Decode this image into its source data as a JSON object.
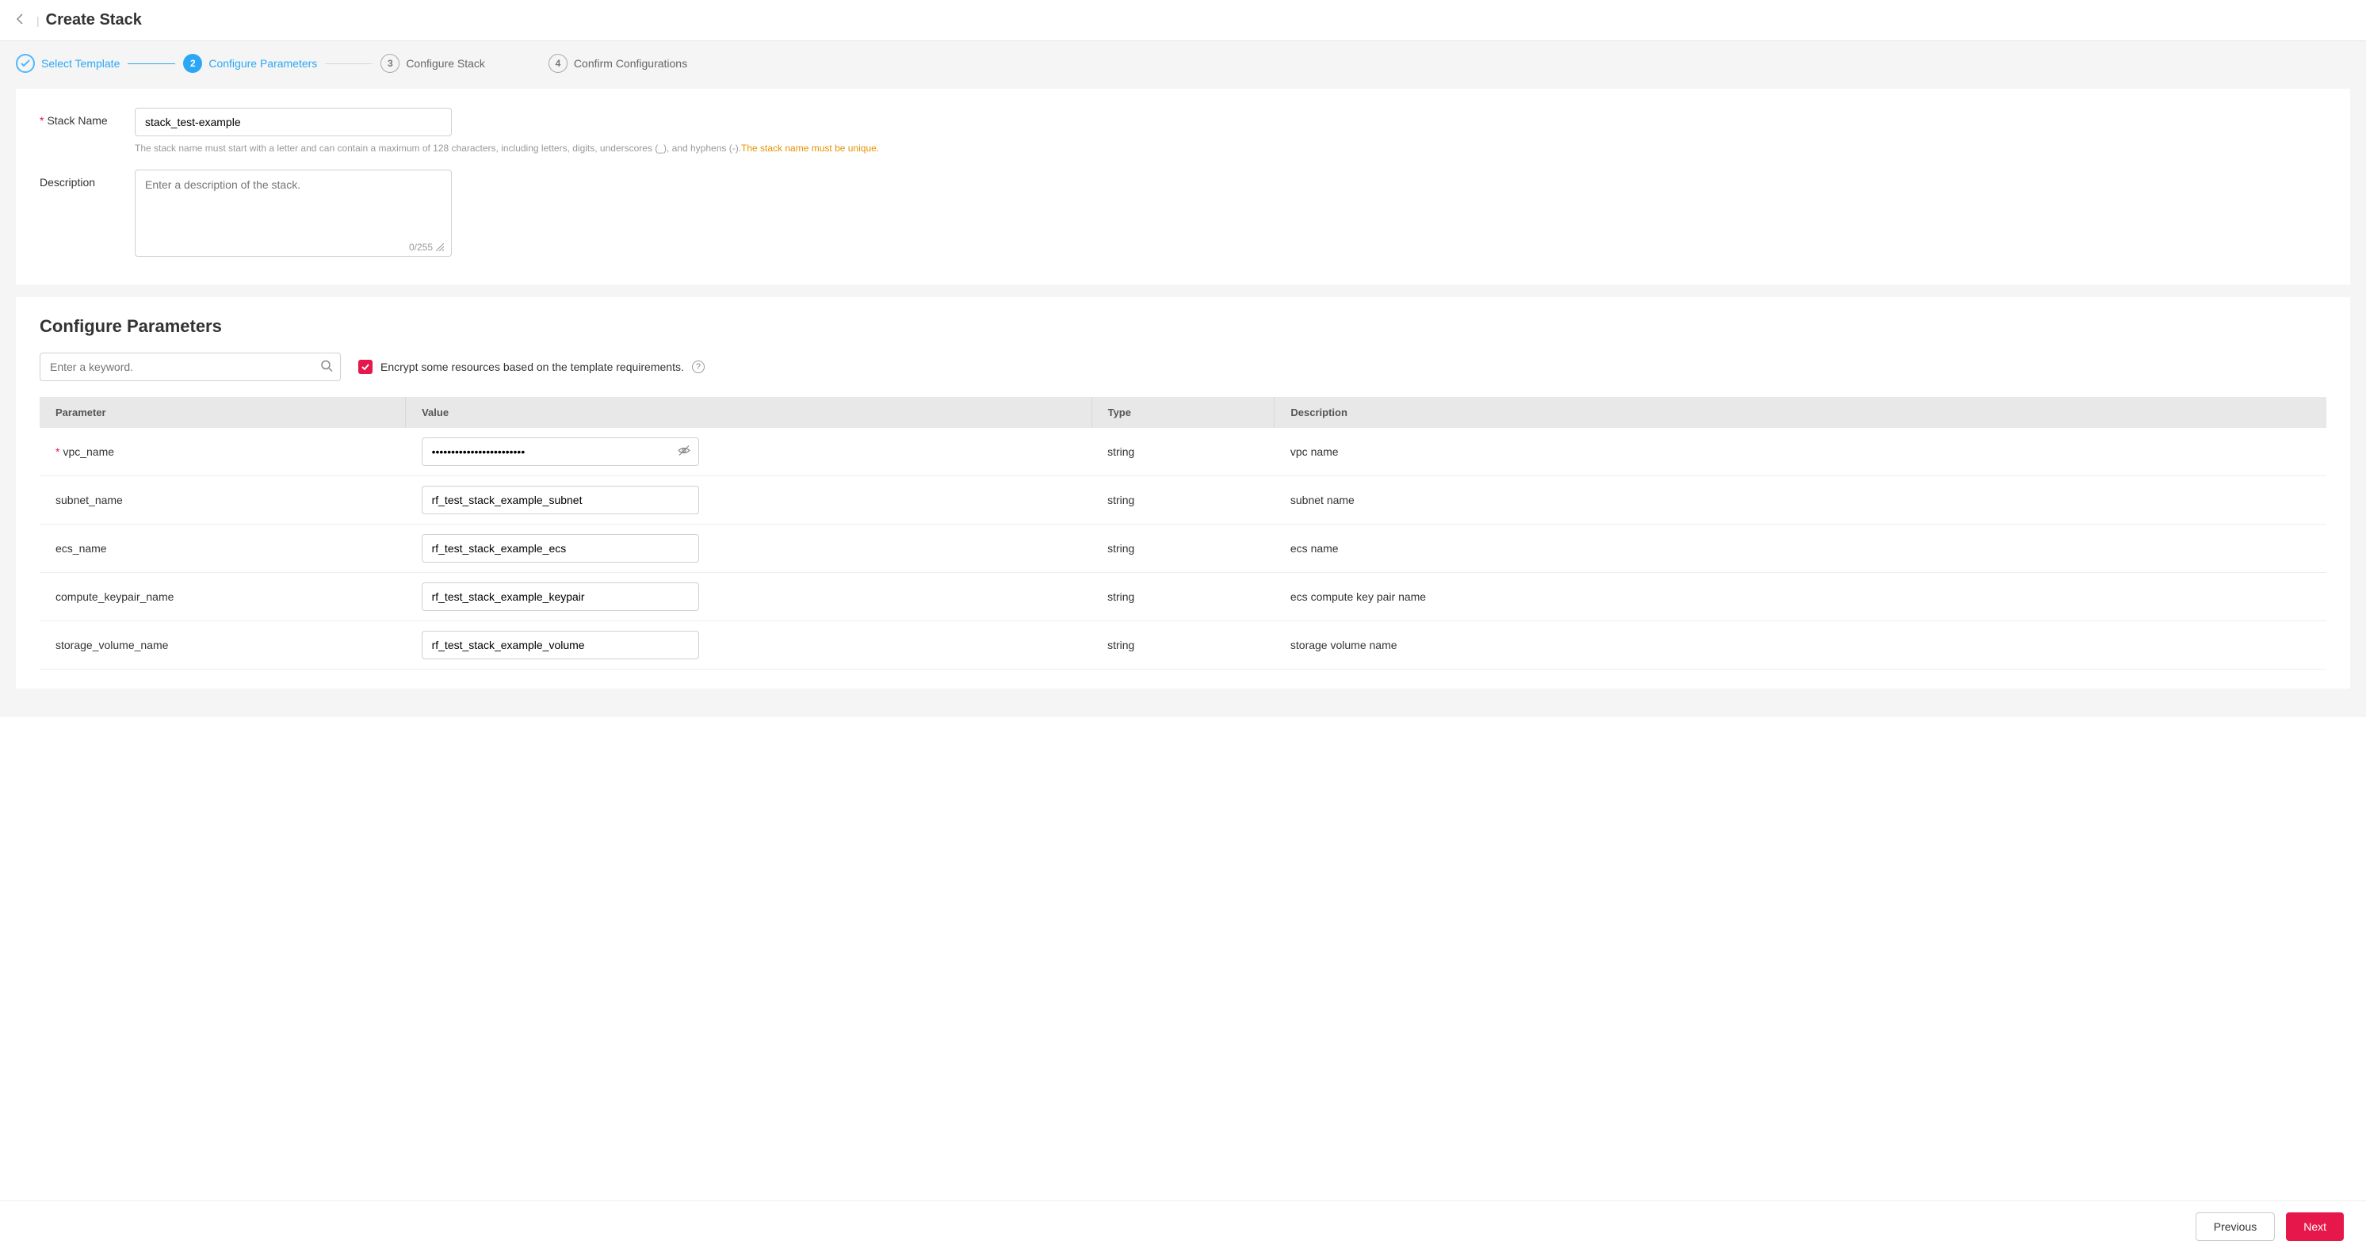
{
  "header": {
    "title": "Create Stack"
  },
  "steps": {
    "s1": "Select Template",
    "s2": "Configure Parameters",
    "s3": "Configure Stack",
    "s4": "Confirm Configurations"
  },
  "form": {
    "stack_name": {
      "label": "Stack Name",
      "value": "stack_test-example"
    },
    "hint_text": "The stack name must start with a letter and can contain a maximum of 128 characters, including letters, digits, underscores (_), and hyphens (-). ",
    "hint_warn": "The stack name must be unique.",
    "description": {
      "label": "Description",
      "placeholder": "Enter a description of the stack.",
      "counter": "0/255"
    }
  },
  "params": {
    "section_title": "Configure Parameters",
    "search_placeholder": "Enter a keyword.",
    "encrypt_label": "Encrypt some resources based on the template requirements.",
    "columns": {
      "parameter": "Parameter",
      "value": "Value",
      "type": "Type",
      "description": "Description"
    },
    "rows": [
      {
        "required": true,
        "name": "vpc_name",
        "value": "••••••••••••••••••••••••",
        "masked": true,
        "type": "string",
        "desc": "vpc name"
      },
      {
        "required": false,
        "name": "subnet_name",
        "value": "rf_test_stack_example_subnet",
        "masked": false,
        "type": "string",
        "desc": "subnet name"
      },
      {
        "required": false,
        "name": "ecs_name",
        "value": "rf_test_stack_example_ecs",
        "masked": false,
        "type": "string",
        "desc": "ecs name"
      },
      {
        "required": false,
        "name": "compute_keypair_name",
        "value": "rf_test_stack_example_keypair",
        "masked": false,
        "type": "string",
        "desc": "ecs compute key pair name"
      },
      {
        "required": false,
        "name": "storage_volume_name",
        "value": "rf_test_stack_example_volume",
        "masked": false,
        "type": "string",
        "desc": "storage volume name"
      }
    ]
  },
  "footer": {
    "previous": "Previous",
    "next": "Next"
  }
}
